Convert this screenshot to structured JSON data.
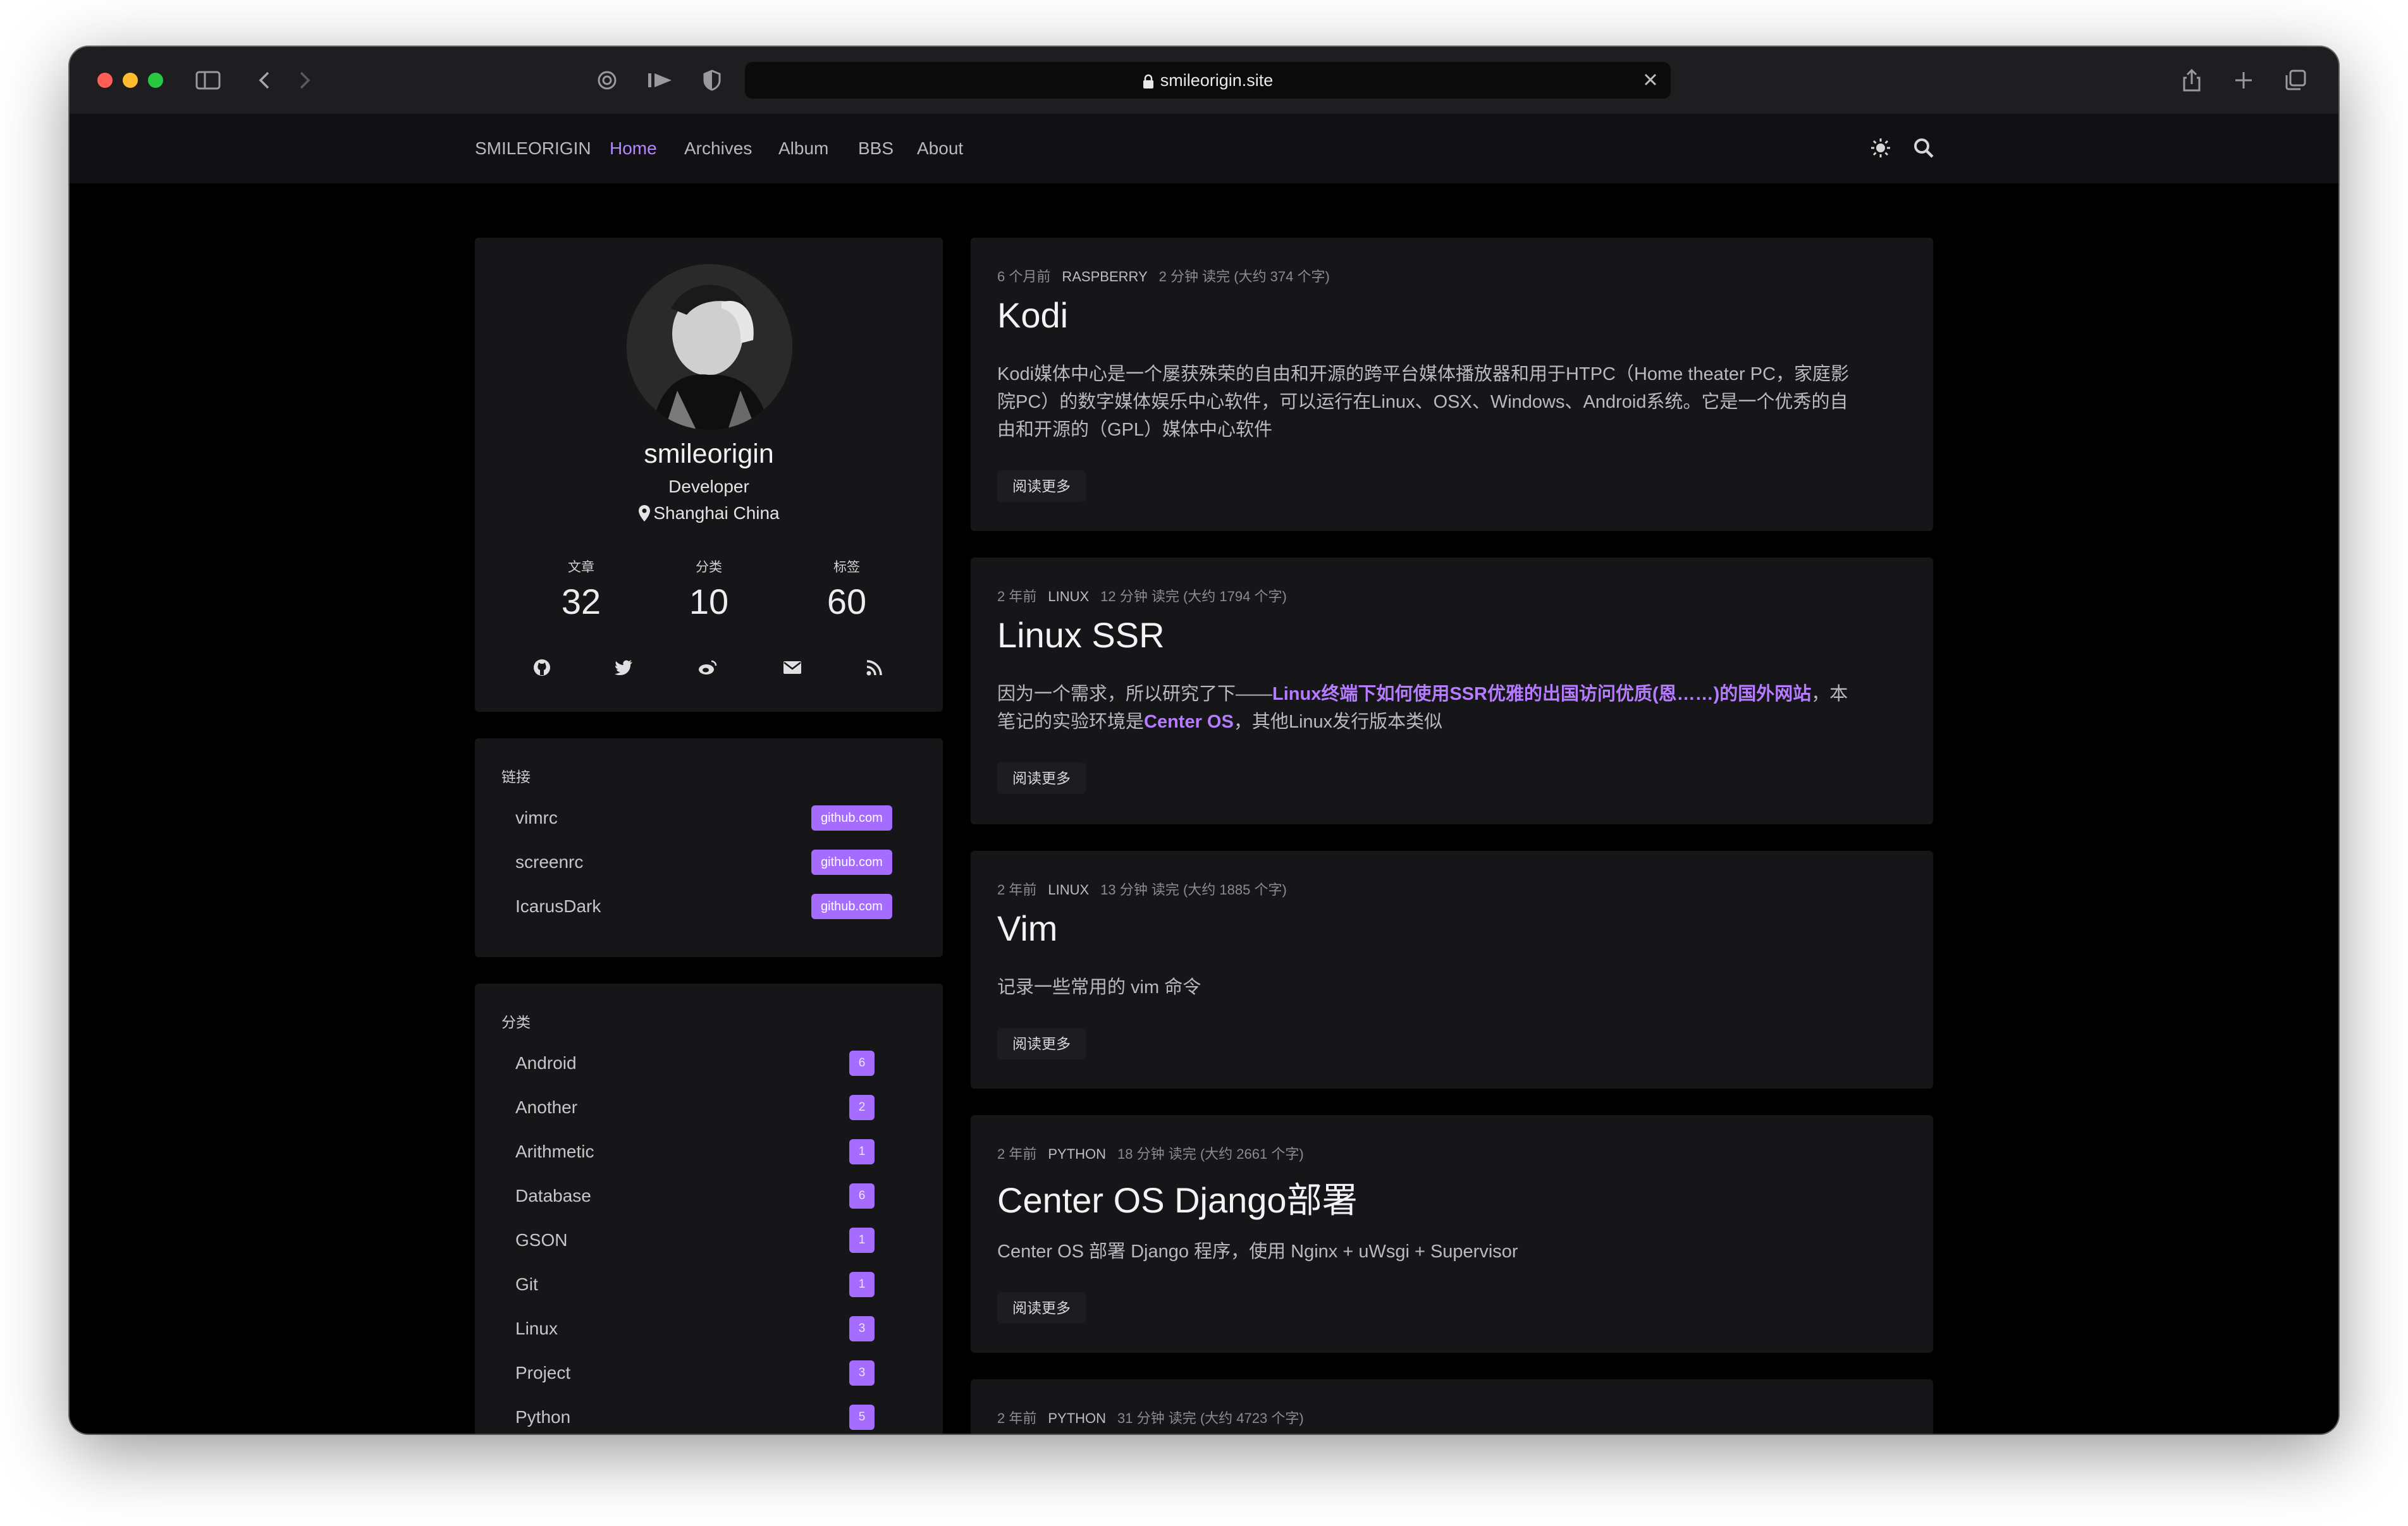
{
  "browser": {
    "url": "smileorigin.site"
  },
  "nav": {
    "brand": "SMILEORIGIN",
    "items": [
      {
        "label": "Home",
        "active": true
      },
      {
        "label": "Archives",
        "active": false
      },
      {
        "label": "Album",
        "active": false
      },
      {
        "label": "BBS",
        "active": false
      },
      {
        "label": "About",
        "active": false
      }
    ]
  },
  "profile": {
    "name": "smileorigin",
    "role": "Developer",
    "location": "Shanghai China",
    "stats": [
      {
        "label": "文章",
        "value": "32"
      },
      {
        "label": "分类",
        "value": "10"
      },
      {
        "label": "标签",
        "value": "60"
      }
    ],
    "social_icons": [
      "github-icon",
      "twitter-icon",
      "weibo-icon",
      "email-icon",
      "rss-icon"
    ]
  },
  "links": {
    "title": "链接",
    "items": [
      {
        "label": "vimrc",
        "domain": "github.com"
      },
      {
        "label": "screenrc",
        "domain": "github.com"
      },
      {
        "label": "IcarusDark",
        "domain": "github.com"
      }
    ]
  },
  "categories": {
    "title": "分类",
    "items": [
      {
        "label": "Android",
        "count": "6"
      },
      {
        "label": "Another",
        "count": "2"
      },
      {
        "label": "Arithmetic",
        "count": "1"
      },
      {
        "label": "Database",
        "count": "6"
      },
      {
        "label": "GSON",
        "count": "1"
      },
      {
        "label": "Git",
        "count": "1"
      },
      {
        "label": "Linux",
        "count": "3"
      },
      {
        "label": "Project",
        "count": "3"
      },
      {
        "label": "Python",
        "count": "5"
      }
    ]
  },
  "posts": [
    {
      "time": "6 个月前",
      "category": "RASPBERRY",
      "reading": "2 分钟 读完 (大约 374 个字)",
      "title": "Kodi",
      "excerpt_line1": "Kodi媒体中心是一个屡获殊荣的自由和开源的跨平台媒体播放器和用于HTPC（Home theater PC，家庭影",
      "excerpt_line2": "院PC）的数字媒体娱乐中心软件，可以运行在Linux、OSX、Windows、Android系统。它是一个优秀的自",
      "excerpt_line3": "由和开源的（GPL）媒体中心软件",
      "read_more": "阅读更多"
    },
    {
      "time": "2 年前",
      "category": "LINUX",
      "reading": "12 分钟 读完 (大约 1794 个字)",
      "title": "Linux SSR",
      "excerpt_a": "因为一个需求，所以研究了下——",
      "excerpt_link": "Linux终端下如何使用SSR优雅的出国访问优质(恩……)的国外网站",
      "excerpt_b": "，本",
      "excerpt_c": "笔记的实验环境是",
      "excerpt_link2": "Center OS",
      "excerpt_d": "，其他Linux发行版本类似",
      "read_more": "阅读更多"
    },
    {
      "time": "2 年前",
      "category": "LINUX",
      "reading": "13 分钟 读完 (大约 1885 个字)",
      "title": "Vim",
      "excerpt": "记录一些常用的 vim 命令",
      "read_more": "阅读更多"
    },
    {
      "time": "2 年前",
      "category": "PYTHON",
      "reading": "18 分钟 读完 (大约 2661 个字)",
      "title": "Center OS Django部署",
      "excerpt": "Center OS 部署 Django 程序，使用 Nginx + uWsgi + Supervisor",
      "read_more": "阅读更多"
    },
    {
      "time": "2 年前",
      "category": "PYTHON",
      "reading": "31 分钟 读完 (大约 4723 个字)"
    }
  ]
}
